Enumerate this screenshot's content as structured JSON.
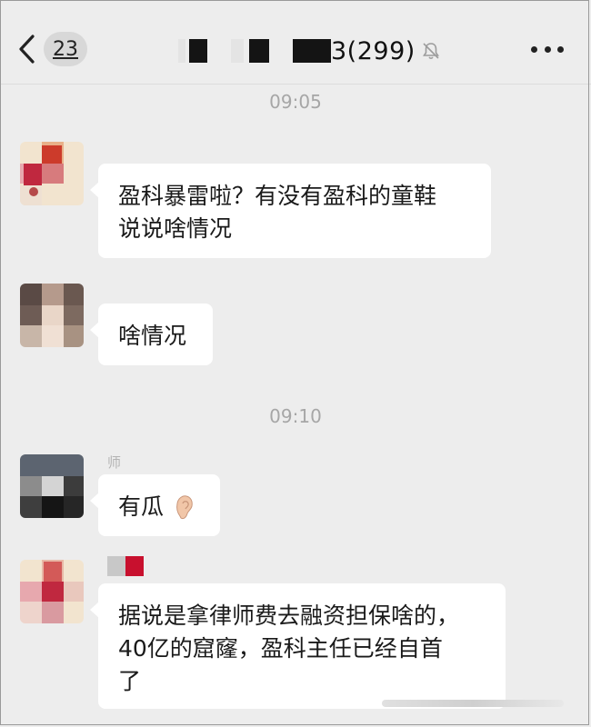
{
  "header": {
    "unread_count": "23",
    "title_visible": "3(299)",
    "mute_icon": "bell-slash-icon",
    "more_icon": "ellipsis-icon"
  },
  "chat": {
    "timestamps": [
      "09:05",
      "09:10"
    ],
    "messages": [
      {
        "sender": "",
        "text_lines": [
          "盈科暴雷啦？有没有盈科的童鞋",
          "说说啥情况"
        ]
      },
      {
        "sender": "",
        "text_lines": [
          "啥情况"
        ]
      },
      {
        "sender": "师",
        "text_lines": [
          "有瓜"
        ],
        "emoji": "ear-icon"
      },
      {
        "sender": "",
        "text_lines": [
          "据说是拿律师费去融资担保啥的，",
          "40亿的窟窿，盈科主任已经自首",
          "了"
        ]
      }
    ]
  },
  "colors": {
    "background": "#ededed",
    "bubble": "#ffffff",
    "timestamp": "#a6a6a6"
  }
}
